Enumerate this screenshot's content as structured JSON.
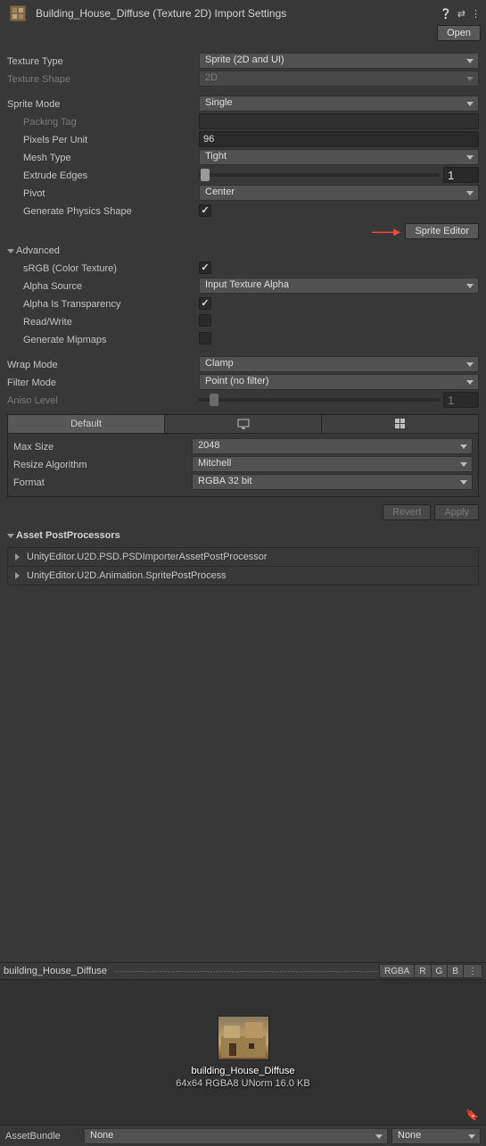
{
  "header": {
    "title": "Building_House_Diffuse (Texture 2D) Import Settings",
    "open_btn": "Open"
  },
  "texture": {
    "type_label": "Texture Type",
    "type_value": "Sprite (2D and UI)",
    "shape_label": "Texture Shape",
    "shape_value": "2D"
  },
  "sprite": {
    "mode_label": "Sprite Mode",
    "mode_value": "Single",
    "packing_tag_label": "Packing Tag",
    "ppu_label": "Pixels Per Unit",
    "ppu_value": "96",
    "mesh_type_label": "Mesh Type",
    "mesh_type_value": "Tight",
    "extrude_label": "Extrude Edges",
    "extrude_value": "1",
    "pivot_label": "Pivot",
    "pivot_value": "Center",
    "gen_physics_label": "Generate Physics Shape",
    "sprite_editor_btn": "Sprite Editor"
  },
  "advanced": {
    "title": "Advanced",
    "srgb_label": "sRGB (Color Texture)",
    "alpha_source_label": "Alpha Source",
    "alpha_source_value": "Input Texture Alpha",
    "alpha_trans_label": "Alpha Is Transparency",
    "readwrite_label": "Read/Write",
    "mipmaps_label": "Generate Mipmaps"
  },
  "wrap": {
    "wrap_label": "Wrap Mode",
    "wrap_value": "Clamp",
    "filter_label": "Filter Mode",
    "filter_value": "Point (no filter)",
    "aniso_label": "Aniso Level",
    "aniso_value": "1"
  },
  "platform": {
    "default_tab": "Default",
    "maxsize_label": "Max Size",
    "maxsize_value": "2048",
    "resize_label": "Resize Algorithm",
    "resize_value": "Mitchell",
    "format_label": "Format",
    "format_value": "RGBA 32 bit"
  },
  "revert_apply": {
    "revert": "Revert",
    "apply": "Apply"
  },
  "postprocessors": {
    "title": "Asset PostProcessors",
    "items": [
      "UnityEditor.U2D.PSD.PSDImporterAssetPostProcessor",
      "UnityEditor.U2D.Animation.SpritePostProcess"
    ]
  },
  "preview": {
    "title": "building_House_Diffuse",
    "rgba": "RGBA",
    "r": "R",
    "g": "G",
    "b": "B",
    "name": "building_House_Diffuse",
    "info": "64x64  RGBA8 UNorm   16.0 KB"
  },
  "assetbundle": {
    "label": "AssetBundle",
    "value1": "None",
    "value2": "None"
  }
}
